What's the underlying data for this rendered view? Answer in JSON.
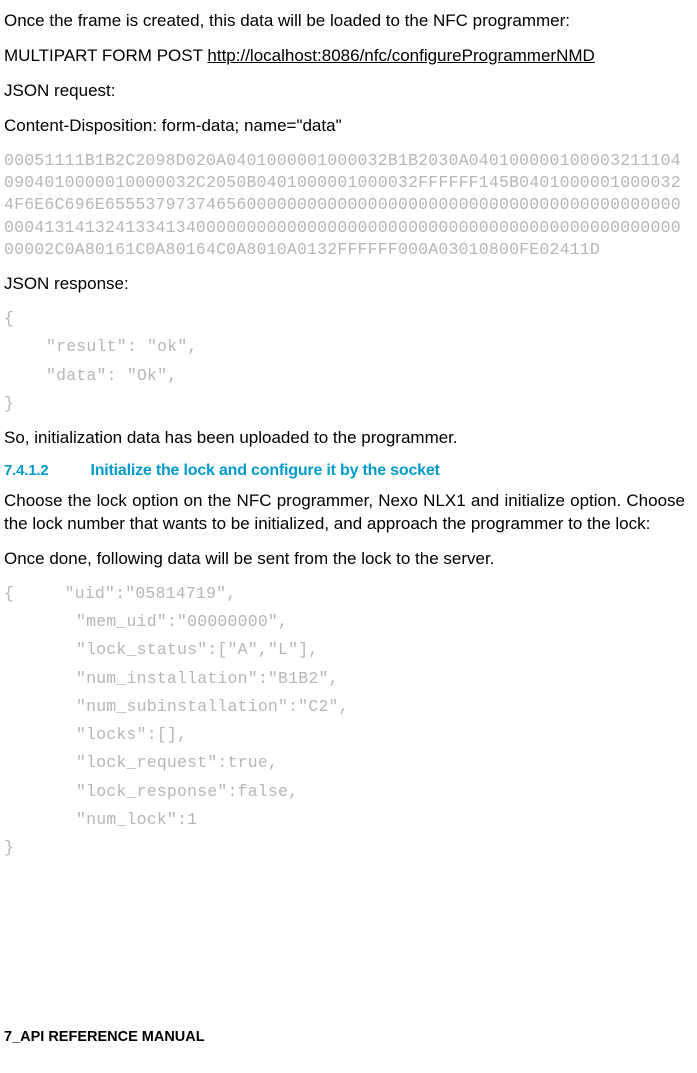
{
  "p1": "Once the frame is created, this data will be loaded to the NFC programmer:",
  "p2_pre": "MULTIPART FORM POST ",
  "p2_url": "http://localhost:8086/nfc/configureProgrammerNMD",
  "p3": "JSON request:",
  "p4": "Content-Disposition: form-data; name=\"data\"",
  "hex": "00051111B1B2C2098D020A0401000001000032B1B2030A0401000001000032111040904010000010000032C2050B0401000001000032FFFFFF145B04010000010000324F6E6C696E655537973746560000000000000000000000000000000000000000000000413141324133413400000000000000000000000000000000000000000000000000002C0A80161C0A80164C0A8010A0132FFFFFF000A03010800FE02411D",
  "p5": "JSON response:",
  "json1_open": "{",
  "json1_line1": "\"result\": \"ok\",",
  "json1_line2": "\"data\": \"Ok\",",
  "json1_close": "}",
  "p6": "So, initialization data has been uploaded to the programmer.",
  "heading_num": "7.4.1.2",
  "heading_title": "Initialize the lock and configure it by the socket",
  "p7": "Choose the lock option on the NFC programmer, Nexo NLX1 and initialize option. Choose the lock number that wants to be initialized, and approach the programmer to the lock:",
  "p8": "Once done, following data will be sent from the lock to the server.",
  "json2_open": "{     \"uid\":\"05814719\",",
  "json2_l1": "\"mem_uid\":\"00000000\",",
  "json2_l2": "\"lock_status\":[\"A\",\"L\"],",
  "json2_l3": "\"num_installation\":\"B1B2\",",
  "json2_l4": "\"num_subinstallation\":\"C2\",",
  "json2_l5": "\"locks\":[],",
  "json2_l6": "\"lock_request\":true,",
  "json2_l7": "\"lock_response\":false,",
  "json2_l8": "\"num_lock\":1",
  "json2_close": "}",
  "footer": "7_API REFERENCE MANUAL"
}
